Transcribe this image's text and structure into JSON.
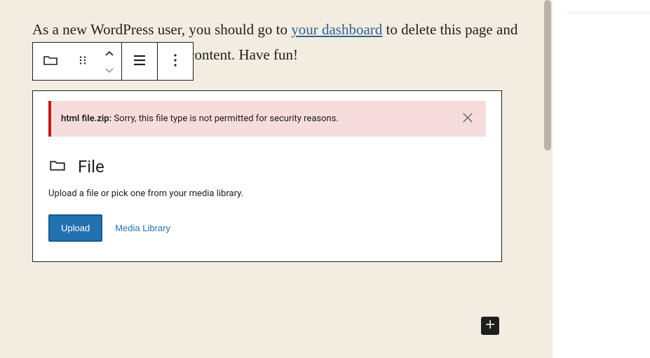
{
  "paragraph": {
    "pre_link": "As a new WordPress user, you should go to ",
    "link_text": "your dashboard",
    "post_link": " to delete this page and create new pages for your content. Have fun!"
  },
  "toolbar": {
    "block_type": "file-block",
    "drag": "drag",
    "move_up": "move-up",
    "move_down": "move-down",
    "align": "align",
    "options": "options"
  },
  "file_block": {
    "notice": {
      "filename": "html file.zip:",
      "message": " Sorry, this file type is not permitted for security reasons."
    },
    "title": "File",
    "description": "Upload a file or pick one from your media library.",
    "upload_label": "Upload",
    "media_library_label": "Media Library"
  },
  "inserter": {
    "label": "Add block"
  }
}
